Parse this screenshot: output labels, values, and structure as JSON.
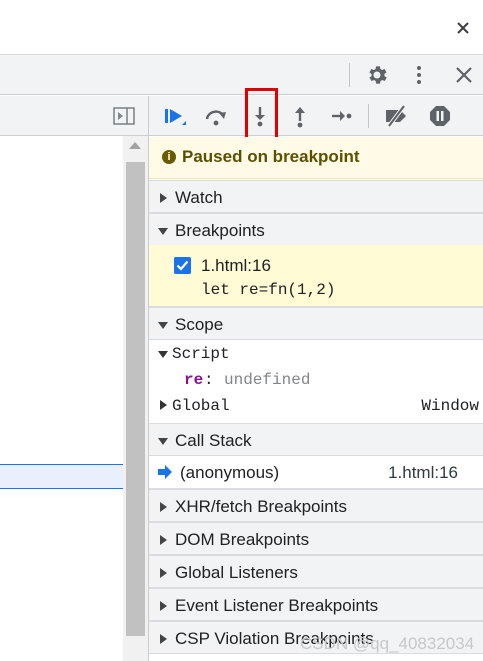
{
  "debugger_paused": {
    "message": "Paused on breakpoint"
  },
  "sections": {
    "watch": "Watch",
    "breakpoints": "Breakpoints",
    "scope": "Scope",
    "call_stack": "Call Stack",
    "xhr_fetch": "XHR/fetch Breakpoints",
    "dom": "DOM Breakpoints",
    "global_listeners": "Global Listeners",
    "event_listener": "Event Listener Breakpoints",
    "csp_violation": "CSP Violation Breakpoints"
  },
  "breakpoint": {
    "location": "1.html:16",
    "code": "let re=fn(1,2)",
    "checked": true
  },
  "scope": {
    "script_label": "Script",
    "var_name": "re",
    "var_sep": ":",
    "var_value": "undefined",
    "global_label": "Global",
    "global_value": "Window"
  },
  "call_stack": {
    "frame_name": "(anonymous)",
    "frame_location": "1.html:16"
  },
  "watermark": "CSDN @qq_40832034",
  "icons": {
    "top_close": "close-icon",
    "settings": "gear-icon",
    "more": "more-vertical-icon",
    "devtools_close": "close-icon",
    "toggle_sidebar": "toggle-sidebar-icon",
    "resume": "resume-icon",
    "step_over": "step-over-icon",
    "step_into": "step-into-icon",
    "step_out": "step-out-icon",
    "step": "step-icon",
    "deactivate_breakpoints": "deactivate-breakpoints-icon",
    "pause_on_exceptions": "pause-on-exceptions-icon"
  },
  "colors": {
    "accent_blue": "#1a73e8",
    "paused_bg": "#fffbe6",
    "breakpoint_bg": "#fffbd5",
    "highlight_red": "#e00000",
    "scope_name_purple": "#881391",
    "undefined_gray": "#80868b"
  }
}
